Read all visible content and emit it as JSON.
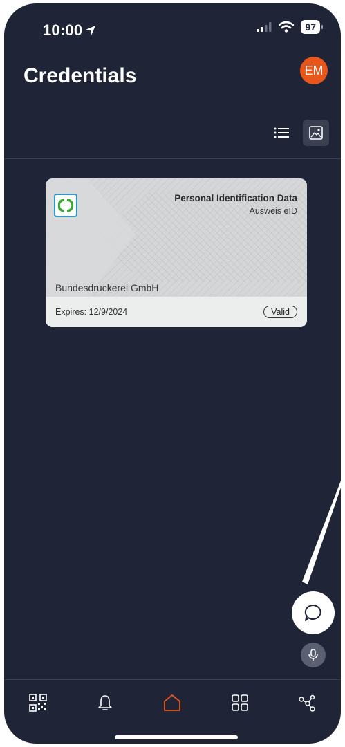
{
  "status_bar": {
    "time": "10:00",
    "battery": "97"
  },
  "header": {
    "title": "Credentials",
    "avatar_initials": "EM"
  },
  "view_toggle": {
    "icons": [
      "list-view-icon",
      "card-view-icon"
    ],
    "active": "card-view"
  },
  "credential_card": {
    "title": "Personal Identification Data",
    "subtitle": "Ausweis eID",
    "issuer": "Bundesdruckerei GmbH",
    "expiry": "Expires: 12/9/2024",
    "status": "Valid"
  },
  "bottom_nav": {
    "items": [
      "qr-code-icon",
      "bell-icon",
      "home-icon",
      "grid-icon",
      "share-nodes-icon"
    ],
    "active": "home"
  },
  "colors": {
    "background": "#1f2437",
    "accent": "#e9561b",
    "card": "#d7d8da"
  }
}
